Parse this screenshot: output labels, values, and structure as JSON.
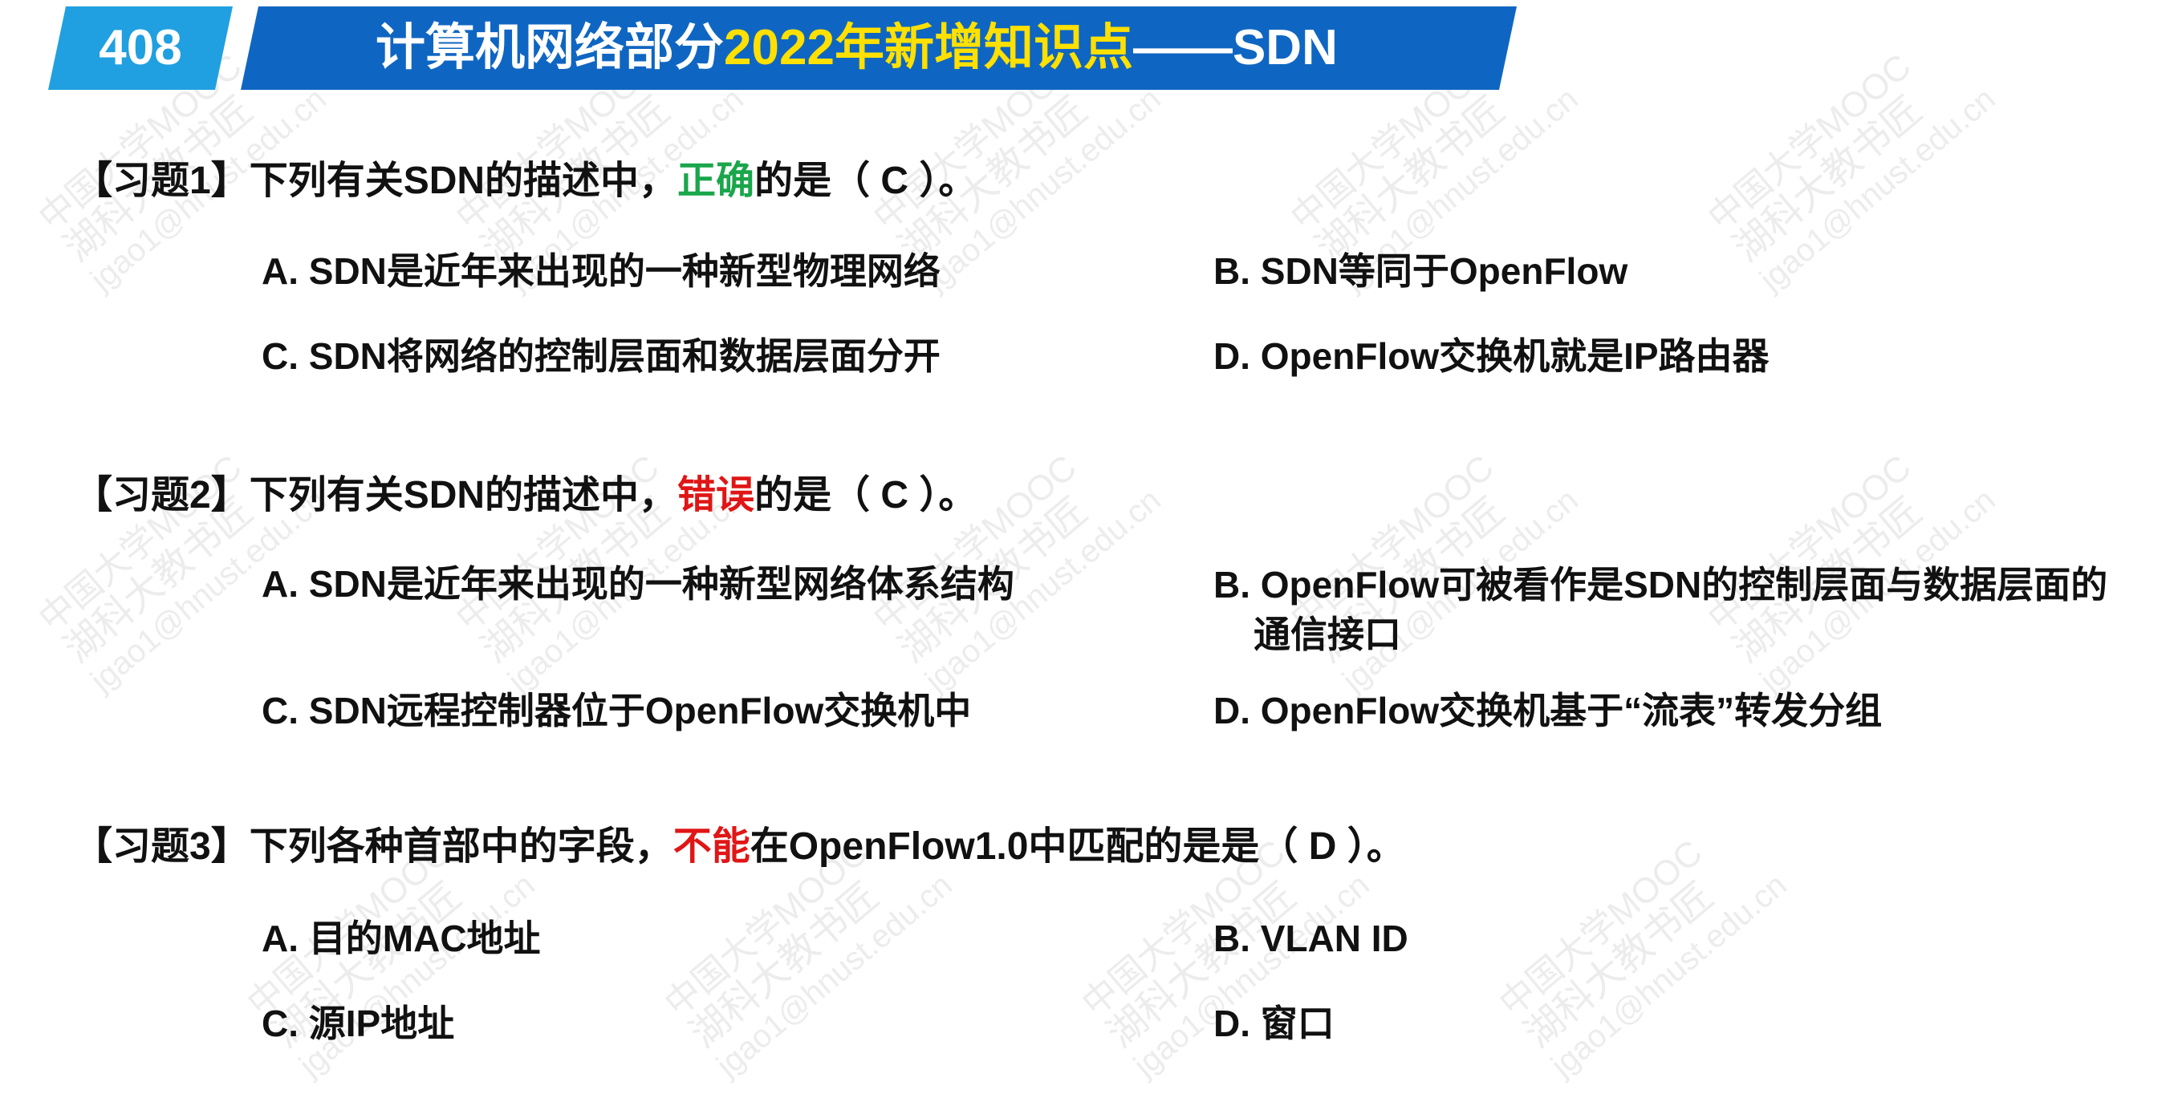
{
  "header": {
    "badge": "408",
    "title_part1": "计算机网络部分",
    "title_part2": "2022年新增知识点",
    "title_part3": "——SDN"
  },
  "questions": [
    {
      "prefix": "【习题1】下列有关SDN的描述中，",
      "highlight": "正确",
      "highlight_color": "#1aa64a",
      "suffix": "的是（ C ）。",
      "options": {
        "A": "A. SDN是近年来出现的一种新型物理网络",
        "B": "B. SDN等同于OpenFlow",
        "C": "C. SDN将网络的控制层面和数据层面分开",
        "D": "D. OpenFlow交换机就是IP路由器"
      }
    },
    {
      "prefix": "【习题2】下列有关SDN的描述中，",
      "highlight": "错误",
      "highlight_color": "#e01616",
      "suffix": "的是（ C ）。",
      "options": {
        "A": "A. SDN是近年来出现的一种新型网络体系结构",
        "B_line1": "B. OpenFlow可被看作是SDN的控制层面与数据层面的",
        "B_line2": "通信接口",
        "C": "C. SDN远程控制器位于OpenFlow交换机中",
        "D": "D. OpenFlow交换机基于“流表”转发分组"
      }
    },
    {
      "prefix": "【习题3】下列各种首部中的字段，",
      "highlight": "不能",
      "highlight_color": "#e01616",
      "suffix": "在OpenFlow1.0中匹配的是是（ D ）。",
      "options": {
        "A": "A. 目的MAC地址",
        "B": "B. VLAN ID",
        "C": "C. 源IP地址",
        "D": "D. 窗口"
      }
    }
  ],
  "watermark": {
    "line1": "中国大学MOOC",
    "line2": "湖科大教书匠",
    "line3": "jgao1@hnust.edu.cn"
  }
}
